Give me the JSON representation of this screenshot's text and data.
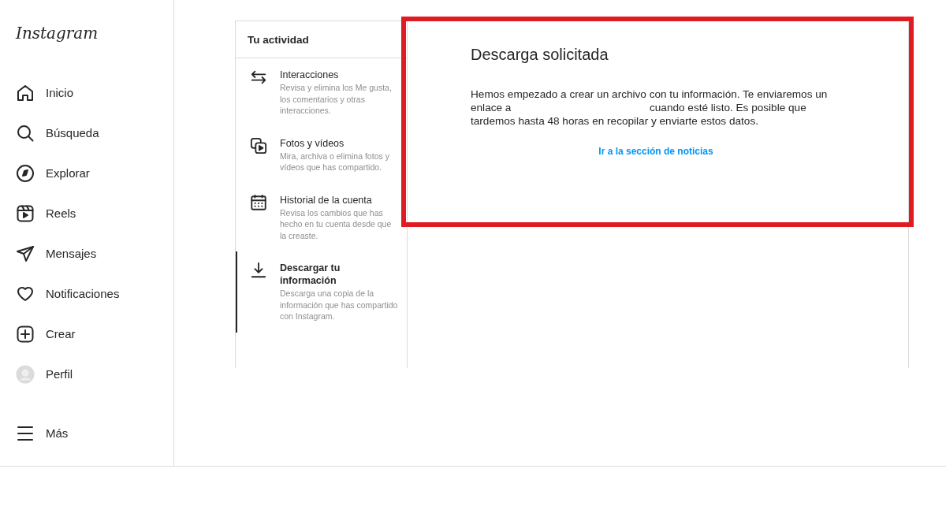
{
  "sidebar": {
    "logo": "Instagram",
    "items": [
      {
        "label": "Inicio"
      },
      {
        "label": "Búsqueda"
      },
      {
        "label": "Explorar"
      },
      {
        "label": "Reels"
      },
      {
        "label": "Mensajes"
      },
      {
        "label": "Notificaciones"
      },
      {
        "label": "Crear"
      },
      {
        "label": "Perfil"
      }
    ],
    "more": {
      "label": "Más"
    }
  },
  "activity": {
    "title": "Tu actividad",
    "items": [
      {
        "title": "Interacciones",
        "description": "Revisa y elimina los Me gusta, los comentarios y otras interacciones.",
        "selected": false
      },
      {
        "title": "Fotos y vídeos",
        "description": "Mira, archiva o elimina fotos y vídeos que has compartido.",
        "selected": false
      },
      {
        "title": "Historial de la cuenta",
        "description": "Revisa los cambios que has hecho en tu cuenta desde que la creaste.",
        "selected": false
      },
      {
        "title": "Descargar tu información",
        "description": "Descarga una copia de la información que has compartido con Instagram.",
        "selected": true
      }
    ]
  },
  "detail": {
    "highlighted": true,
    "title": "Descarga solicitada",
    "body_before": "Hemos empezado a crear un archivo con tu información. Te enviaremos un enlace a",
    "body_after": "cuando esté listo. Es posible que tardemos hasta 48 horas en recopilar y enviarte estos datos.",
    "link": "Ir a la sección de noticias"
  }
}
